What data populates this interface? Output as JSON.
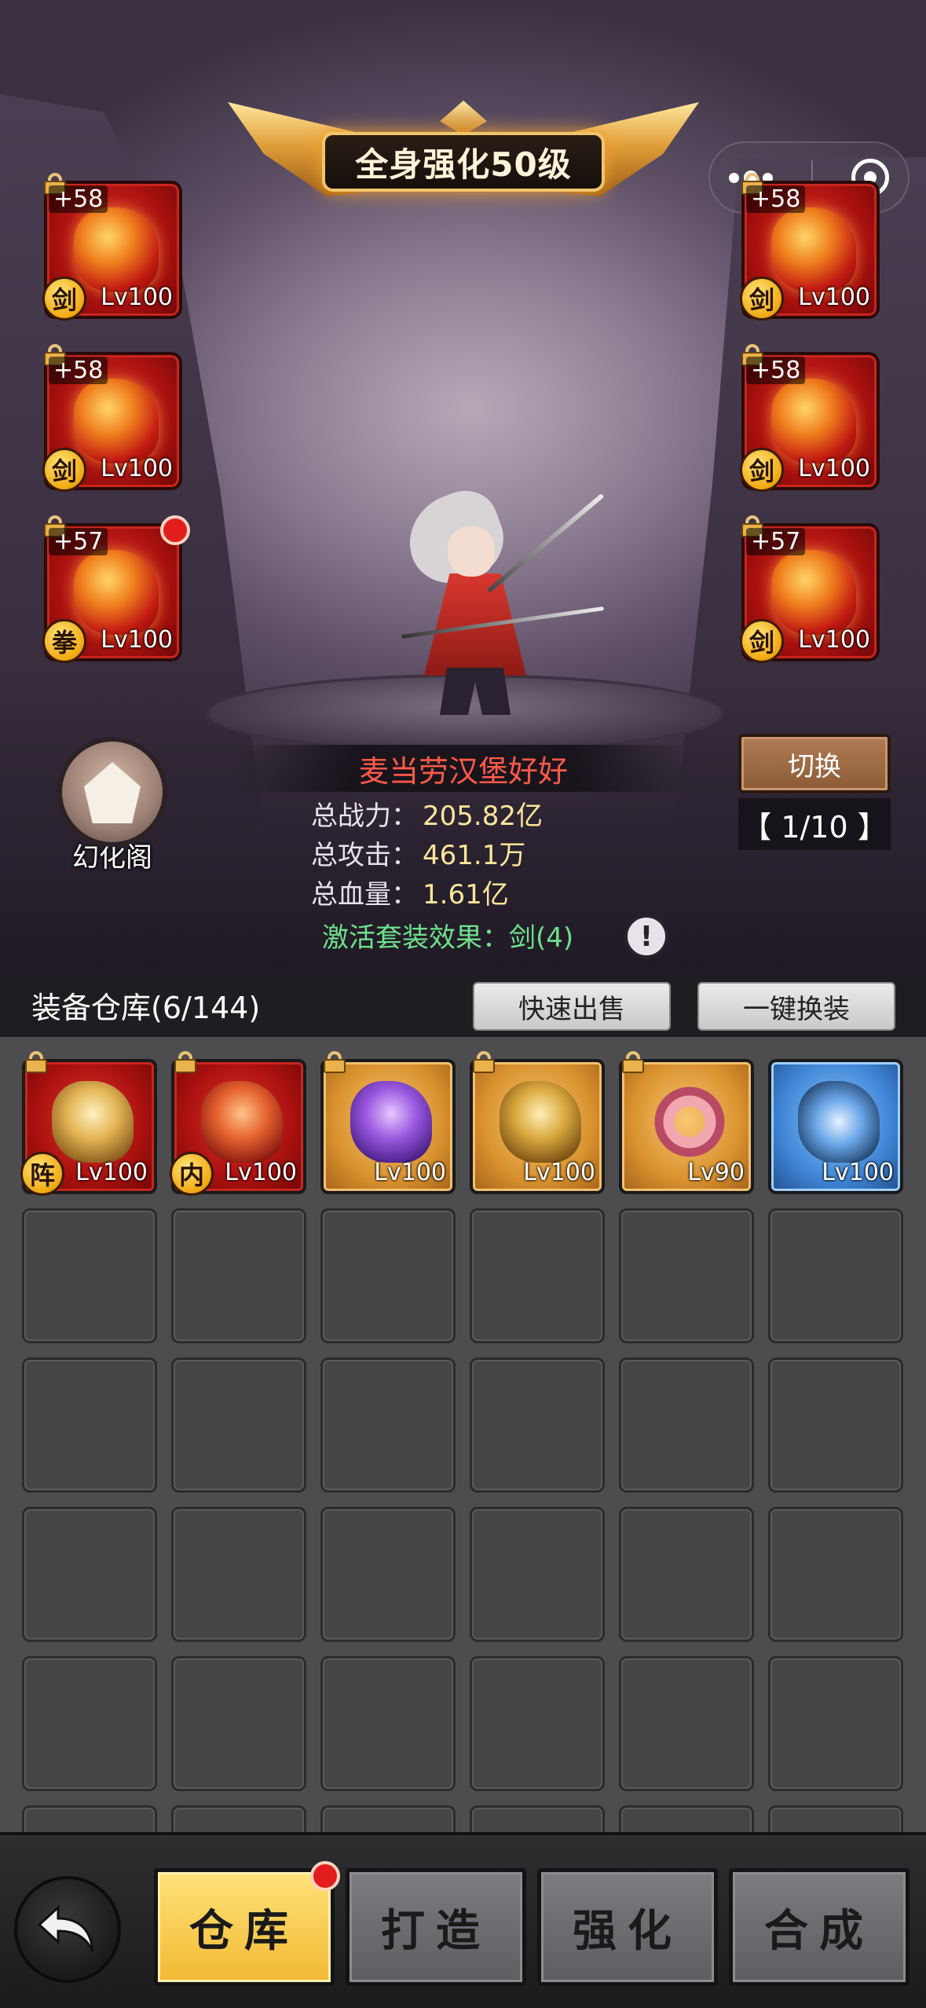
{
  "banner": {
    "title": "全身强化50级"
  },
  "equipped_left": [
    {
      "plus": "+58",
      "badge": "剑",
      "level": "Lv100",
      "icon": "sword-icon",
      "red_dot": false
    },
    {
      "plus": "+58",
      "badge": "剑",
      "level": "Lv100",
      "icon": "flame-armor-icon",
      "red_dot": false
    },
    {
      "plus": "+57",
      "badge": "拳",
      "level": "Lv100",
      "icon": "fist-weapon-icon",
      "red_dot": true
    }
  ],
  "equipped_right": [
    {
      "plus": "+58",
      "badge": "剑",
      "level": "Lv100",
      "icon": "helmet-icon",
      "red_dot": false
    },
    {
      "plus": "+58",
      "badge": "剑",
      "level": "Lv100",
      "icon": "boots-icon",
      "red_dot": false
    },
    {
      "plus": "+57",
      "badge": "剑",
      "level": "Lv100",
      "icon": "belt-icon",
      "red_dot": false
    }
  ],
  "pavilion": {
    "label": "幻化阁",
    "icon": "armor-silhouette-icon"
  },
  "character": {
    "name": "麦当劳汉堡好好",
    "stats": [
      {
        "key": "总战力：",
        "value": "205.82亿"
      },
      {
        "key": "总攻击：",
        "value": "461.1万"
      },
      {
        "key": "总血量：",
        "value": "1.61亿"
      }
    ],
    "set_effect": "激活套装效果：剑(4)"
  },
  "switch": {
    "label": "切换",
    "page": "【 1/10 】"
  },
  "inventory": {
    "title": "装备仓库(6/144)",
    "quick_sell": "快速出售",
    "one_click_equip": "一键换装",
    "items": [
      {
        "quality": "red",
        "art": "helm-gold",
        "badge": "阵",
        "level": "Lv100",
        "locked": true,
        "icon": "golden-helmet-icon"
      },
      {
        "quality": "red",
        "art": "boots-red",
        "badge": "内",
        "level": "Lv100",
        "locked": true,
        "icon": "red-boots-icon"
      },
      {
        "quality": "gold",
        "art": "boots-purple",
        "badge": "",
        "level": "Lv100",
        "locked": true,
        "icon": "purple-boots-icon"
      },
      {
        "quality": "gold",
        "art": "boots-gold",
        "badge": "",
        "level": "Lv100",
        "locked": true,
        "icon": "gold-boots-icon"
      },
      {
        "quality": "gold",
        "art": "ring-pink",
        "badge": "",
        "level": "Lv90",
        "locked": true,
        "icon": "pink-belt-icon"
      },
      {
        "quality": "blue",
        "art": "crown-blue",
        "badge": "",
        "level": "Lv100",
        "locked": false,
        "icon": "blue-crown-icon"
      }
    ]
  },
  "bottom_nav": {
    "back_icon": "back-arrow-icon",
    "tabs": [
      {
        "label": "仓库",
        "active": true,
        "red_dot": true
      },
      {
        "label": "打造",
        "active": false,
        "red_dot": false
      },
      {
        "label": "强化",
        "active": false,
        "red_dot": false
      },
      {
        "label": "合成",
        "active": false,
        "red_dot": false
      }
    ]
  },
  "colors": {
    "name": "#ff5a4a",
    "stat_value": "#ffe59a",
    "set_effect": "#6ee28c",
    "active_tab": "#f2b933"
  }
}
